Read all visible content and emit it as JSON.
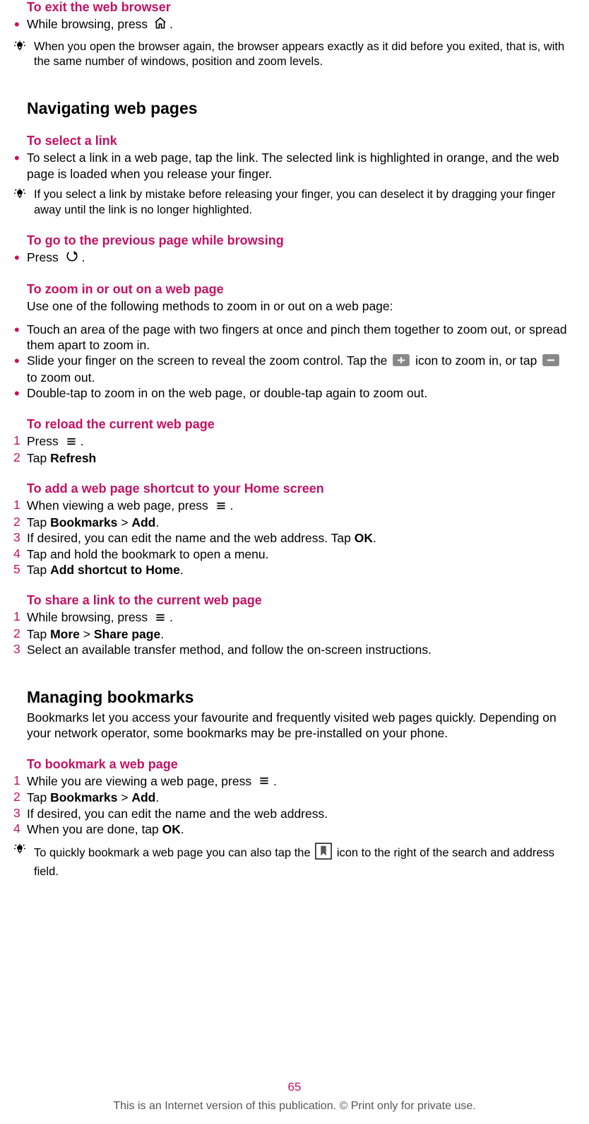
{
  "s1": {
    "h": "To exit the web browser",
    "b1a": "While browsing, press ",
    "b1b": ".",
    "tip": "When you open the browser again, the browser appears exactly as it did before you exited, that is, with the same number of windows, position and zoom levels."
  },
  "s2": {
    "h": "Navigating web pages",
    "sel_h": "To select a link",
    "sel_b": "To select a link in a web page, tap the link. The selected link is highlighted in orange, and the web page is loaded when you release your finger.",
    "sel_tip": "If you select a link by mistake before releasing your finger, you can deselect it by dragging your finger away until the link is no longer highlighted.",
    "prev_h": "To go to the previous page while browsing",
    "prev_b1a": "Press ",
    "prev_b1b": ".",
    "zoom_h": "To zoom in or out on a web page",
    "zoom_intro": "Use one of the following methods to zoom in or out on a web page:",
    "zoom_b1": "Touch an area of the page with two fingers at once and pinch them together to zoom out, or spread them apart to zoom in.",
    "zoom_b2a": "Slide your finger on the screen to reveal the zoom control. Tap the ",
    "zoom_b2b": " icon to zoom in, or tap ",
    "zoom_b2c": " to zoom out.",
    "zoom_b3": "Double-tap to zoom in on the web page, or double-tap again to zoom out.",
    "reload_h": "To reload the current web page",
    "reload_o1a": "Press ",
    "reload_o1b": ".",
    "reload_o2a": "Tap ",
    "reload_o2b": "Refresh",
    "short_h": "To add a web page shortcut to your Home screen",
    "short_o1a": "When viewing a web page, press ",
    "short_o1b": ".",
    "short_o2a": "Tap ",
    "short_o2b": "Bookmarks",
    "short_o2c": " > ",
    "short_o2d": "Add",
    "short_o2e": ".",
    "short_o3a": "If desired, you can edit the name and the web address. Tap ",
    "short_o3b": "OK",
    "short_o3c": ".",
    "short_o4": "Tap and hold the bookmark to open a menu.",
    "short_o5a": "Tap ",
    "short_o5b": "Add shortcut to Home",
    "short_o5c": ".",
    "share_h": "To share a link to the current web page",
    "share_o1a": "While browsing, press ",
    "share_o1b": ".",
    "share_o2a": "Tap ",
    "share_o2b": "More",
    "share_o2c": " > ",
    "share_o2d": "Share page",
    "share_o2e": ".",
    "share_o3": "Select an available transfer method, and follow the on-screen instructions."
  },
  "s3": {
    "h": "Managing bookmarks",
    "intro": "Bookmarks let you access your favourite and frequently visited web pages quickly. Depending on your network operator, some bookmarks may be pre-installed on your phone.",
    "bm_h": "To bookmark a web page",
    "bm_o1a": "While you are viewing a web page, press ",
    "bm_o1b": ".",
    "bm_o2a": "Tap ",
    "bm_o2b": "Bookmarks",
    "bm_o2c": " > ",
    "bm_o2d": "Add",
    "bm_o2e": ".",
    "bm_o3": "If desired, you can edit the name and the web address.",
    "bm_o4a": "When you are done, tap ",
    "bm_o4b": "OK",
    "bm_o4c": ".",
    "bm_tip_a": "To quickly bookmark a web page you can also tap the ",
    "bm_tip_b": " icon to the right of the search and address field."
  },
  "footer": {
    "page": "65",
    "text": "This is an Internet version of this publication. © Print only for private use."
  },
  "nums": {
    "n1": "1",
    "n2": "2",
    "n3": "3",
    "n4": "4",
    "n5": "5"
  }
}
